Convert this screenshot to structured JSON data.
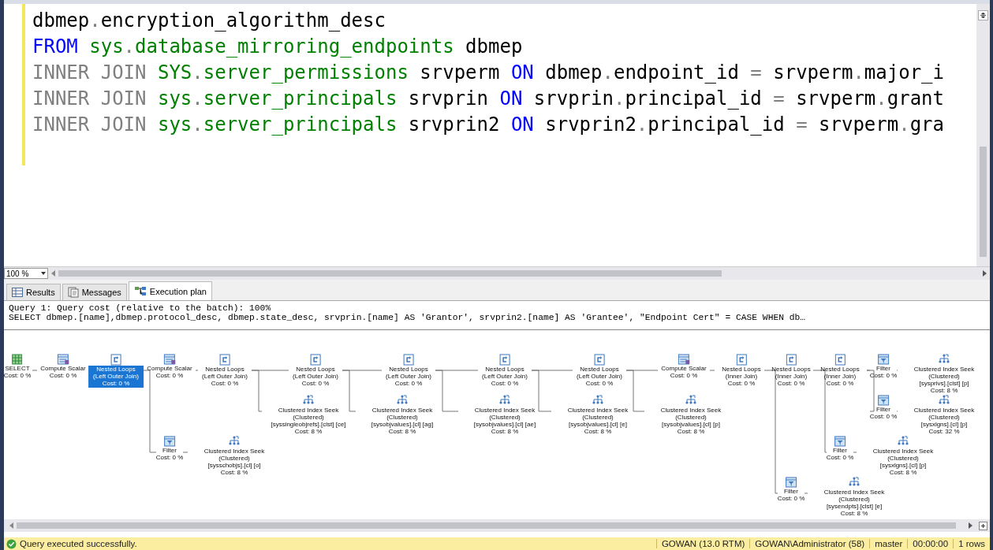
{
  "editor": {
    "lines": [
      [
        {
          "kind": "plain",
          "text": "dbmep"
        },
        {
          "kind": "operator",
          "text": "."
        },
        {
          "kind": "plain",
          "text": "encryption_algorithm_desc"
        }
      ],
      [
        {
          "kind": "keyword",
          "text": "FROM "
        },
        {
          "kind": "system",
          "text": "sys"
        },
        {
          "kind": "operator",
          "text": "."
        },
        {
          "kind": "system",
          "text": "database_mirroring_endpoints"
        },
        {
          "kind": "plain",
          "text": " dbmep"
        }
      ],
      [
        {
          "kind": "operator",
          "text": "INNER JOIN "
        },
        {
          "kind": "system",
          "text": "SYS"
        },
        {
          "kind": "operator",
          "text": "."
        },
        {
          "kind": "system",
          "text": "server_permissions"
        },
        {
          "kind": "plain",
          "text": " srvperm "
        },
        {
          "kind": "keyword",
          "text": "ON"
        },
        {
          "kind": "plain",
          "text": " dbmep"
        },
        {
          "kind": "operator",
          "text": "."
        },
        {
          "kind": "plain",
          "text": "endpoint_id "
        },
        {
          "kind": "operator",
          "text": "="
        },
        {
          "kind": "plain",
          "text": " srvperm"
        },
        {
          "kind": "operator",
          "text": "."
        },
        {
          "kind": "plain",
          "text": "major_i"
        }
      ],
      [
        {
          "kind": "operator",
          "text": "INNER JOIN "
        },
        {
          "kind": "system",
          "text": "sys"
        },
        {
          "kind": "operator",
          "text": "."
        },
        {
          "kind": "system",
          "text": "server_principals"
        },
        {
          "kind": "plain",
          "text": " srvprin "
        },
        {
          "kind": "keyword",
          "text": "ON"
        },
        {
          "kind": "plain",
          "text": " srvprin"
        },
        {
          "kind": "operator",
          "text": "."
        },
        {
          "kind": "plain",
          "text": "principal_id "
        },
        {
          "kind": "operator",
          "text": "="
        },
        {
          "kind": "plain",
          "text": " srvperm"
        },
        {
          "kind": "operator",
          "text": "."
        },
        {
          "kind": "plain",
          "text": "grant"
        }
      ],
      [
        {
          "kind": "operator",
          "text": "INNER JOIN "
        },
        {
          "kind": "system",
          "text": "sys"
        },
        {
          "kind": "operator",
          "text": "."
        },
        {
          "kind": "system",
          "text": "server_principals"
        },
        {
          "kind": "plain",
          "text": " srvprin2 "
        },
        {
          "kind": "keyword",
          "text": "ON"
        },
        {
          "kind": "plain",
          "text": " srvprin2"
        },
        {
          "kind": "operator",
          "text": "."
        },
        {
          "kind": "plain",
          "text": "principal_id "
        },
        {
          "kind": "operator",
          "text": "="
        },
        {
          "kind": "plain",
          "text": " srvperm"
        },
        {
          "kind": "operator",
          "text": "."
        },
        {
          "kind": "plain",
          "text": "gra"
        }
      ]
    ],
    "zoom": "100 %"
  },
  "tabs": [
    {
      "label": "Results",
      "kind": "grid",
      "selected": false
    },
    {
      "label": "Messages",
      "kind": "messages",
      "selected": false
    },
    {
      "label": "Execution plan",
      "kind": "plan",
      "selected": true
    }
  ],
  "plan": {
    "query_header": "Query 1: Query cost (relative to the batch): 100%",
    "statement": "SELECT dbmep.[name],dbmep.protocol_desc, dbmep.state_desc, srvprin.[name] AS 'Grantor', srvprin2.[name] AS 'Grantee', \"Endpoint Cert\" = CASE WHEN db…",
    "root": {
      "kind": "select",
      "lines": [
        "SELECT",
        "Cost: 0 %"
      ],
      "selected": false,
      "children": [
        {
          "kind": "compute",
          "lines": [
            "Compute Scalar",
            "Cost: 0 %"
          ],
          "selected": false,
          "children": [
            {
              "kind": "loops",
              "lines": [
                "Nested Loops",
                "(Left Outer Join)",
                "Cost: 0 %"
              ],
              "selected": true,
              "children": [
                {
                  "kind": "compute",
                  "lines": [
                    "Compute Scalar",
                    "Cost: 0 %"
                  ],
                  "selected": false,
                  "children": [
                    {
                      "kind": "loops",
                      "lines": [
                        "Nested Loops",
                        "(Left Outer Join)",
                        "Cost: 0 %"
                      ],
                      "selected": false,
                      "children": [
                        {
                          "kind": "loops",
                          "lines": [
                            "Nested Loops",
                            "(Left Outer Join)",
                            "Cost: 0 %"
                          ],
                          "selected": false,
                          "children": [
                            {
                              "kind": "loops",
                              "lines": [
                                "Nested Loops",
                                "(Left Outer Join)",
                                "Cost: 0 %"
                              ],
                              "selected": false,
                              "children": [
                                {
                                  "kind": "loops",
                                  "lines": [
                                    "Nested Loops",
                                    "(Left Outer Join)",
                                    "Cost: 0 %"
                                  ],
                                  "selected": false,
                                  "children": [
                                    {
                                      "kind": "loops",
                                      "lines": [
                                        "Nested Loops",
                                        "(Left Outer Join)",
                                        "Cost: 0 %"
                                      ],
                                      "selected": false,
                                      "children": [
                                        {
                                          "kind": "compute",
                                          "lines": [
                                            "Compute Scalar",
                                            "Cost: 0 %"
                                          ],
                                          "selected": false,
                                          "children": [
                                            {
                                              "kind": "loops",
                                              "lines": [
                                                "Nested Loops",
                                                "(Inner Join)",
                                                "Cost: 0 %"
                                              ],
                                              "selected": false,
                                              "children": [
                                                {
                                                  "kind": "loops",
                                                  "lines": [
                                                    "Nested Loops",
                                                    "(Inner Join)",
                                                    "Cost: 0 %"
                                                  ],
                                                  "selected": false,
                                                  "children": [
                                                    {
                                                      "kind": "loops",
                                                      "lines": [
                                                        "Nested Loops",
                                                        "(Inner Join)",
                                                        "Cost: 0 %"
                                                      ],
                                                      "selected": false,
                                                      "children": [
                                                        {
                                                          "kind": "filter",
                                                          "lines": [
                                                            "Filter",
                                                            "Cost: 0 %"
                                                          ],
                                                          "selected": false,
                                                          "children": [
                                                            {
                                                              "kind": "seek",
                                                              "lines": [
                                                                "Clustered Index Seek (Clustered)",
                                                                "[sysprivs].[clst] [p]",
                                                                "Cost: 8 %"
                                                              ],
                                                              "selected": false
                                                            }
                                                          ]
                                                        },
                                                        {
                                                          "kind": "filter",
                                                          "lines": [
                                                            "Filter",
                                                            "Cost: 0 %"
                                                          ],
                                                          "selected": false,
                                                          "children": [
                                                            {
                                                              "kind": "seek",
                                                              "lines": [
                                                                "Clustered Index Seek (Clustered)",
                                                                "[sysxlgns].[cl] [p]",
                                                                "Cost: 32 %"
                                                              ],
                                                              "selected": false
                                                            }
                                                          ]
                                                        }
                                                      ]
                                                    },
                                                    {
                                                      "kind": "filter",
                                                      "lines": [
                                                        "Filter",
                                                        "Cost: 0 %"
                                                      ],
                                                      "selected": false,
                                                      "children": [
                                                        {
                                                          "kind": "seek",
                                                          "lines": [
                                                            "Clustered Index Seek (Clustered)",
                                                            "[sysxlgns].[cl] [p]",
                                                            "Cost: 8 %"
                                                          ],
                                                          "selected": false
                                                        }
                                                      ]
                                                    }
                                                  ]
                                                },
                                                {
                                                  "kind": "filter",
                                                  "lines": [
                                                    "Filter",
                                                    "Cost: 0 %"
                                                  ],
                                                  "selected": false,
                                                  "children": [
                                                    {
                                                      "kind": "seek",
                                                      "lines": [
                                                        "Clustered Index Seek (Clustered)",
                                                        "[sysendpts].[clst] [e]",
                                                        "Cost: 8 %"
                                                      ],
                                                      "selected": false
                                                    }
                                                  ]
                                                }
                                              ]
                                            }
                                          ]
                                        },
                                        {
                                          "kind": "seek",
                                          "lines": [
                                            "Clustered Index Seek (Clustered)",
                                            "[sysobjvalues].[cl] [p]",
                                            "Cost: 8 %"
                                          ],
                                          "selected": false
                                        }
                                      ]
                                    },
                                    {
                                      "kind": "seek",
                                      "lines": [
                                        "Clustered Index Seek (Clustered)",
                                        "[sysobjvalues].[cl] [e]",
                                        "Cost: 8 %"
                                      ],
                                      "selected": false
                                    }
                                  ]
                                },
                                {
                                  "kind": "seek",
                                  "lines": [
                                    "Clustered Index Seek (Clustered)",
                                    "[sysobjvalues].[cl] [ae]",
                                    "Cost: 8 %"
                                  ],
                                  "selected": false
                                }
                              ]
                            },
                            {
                              "kind": "seek",
                              "lines": [
                                "Clustered Index Seek (Clustered)",
                                "[sysobjvalues].[cl] [ag]",
                                "Cost: 8 %"
                              ],
                              "selected": false
                            }
                          ]
                        },
                        {
                          "kind": "seek",
                          "lines": [
                            "Clustered Index Seek (Clustered)",
                            "[syssingleobjrefs].[clst] [ce]",
                            "Cost: 8 %"
                          ],
                          "selected": false
                        }
                      ]
                    }
                  ]
                },
                {
                  "kind": "filter",
                  "lines": [
                    "Filter",
                    "Cost: 0 %"
                  ],
                  "selected": false,
                  "children": [
                    {
                      "kind": "seek",
                      "lines": [
                        "Clustered Index Seek (Clustered)",
                        "[sysschobjs].[cl] [o]",
                        "Cost: 8 %"
                      ],
                      "selected": false
                    }
                  ]
                }
              ]
            }
          ]
        }
      ]
    }
  },
  "status_bar": {
    "message": "Query executed successfully.",
    "segments": [
      "GOWAN (13.0 RTM)",
      "GOWAN\\Administrator (58)",
      "master",
      "00:00:00",
      "1 rows"
    ]
  }
}
